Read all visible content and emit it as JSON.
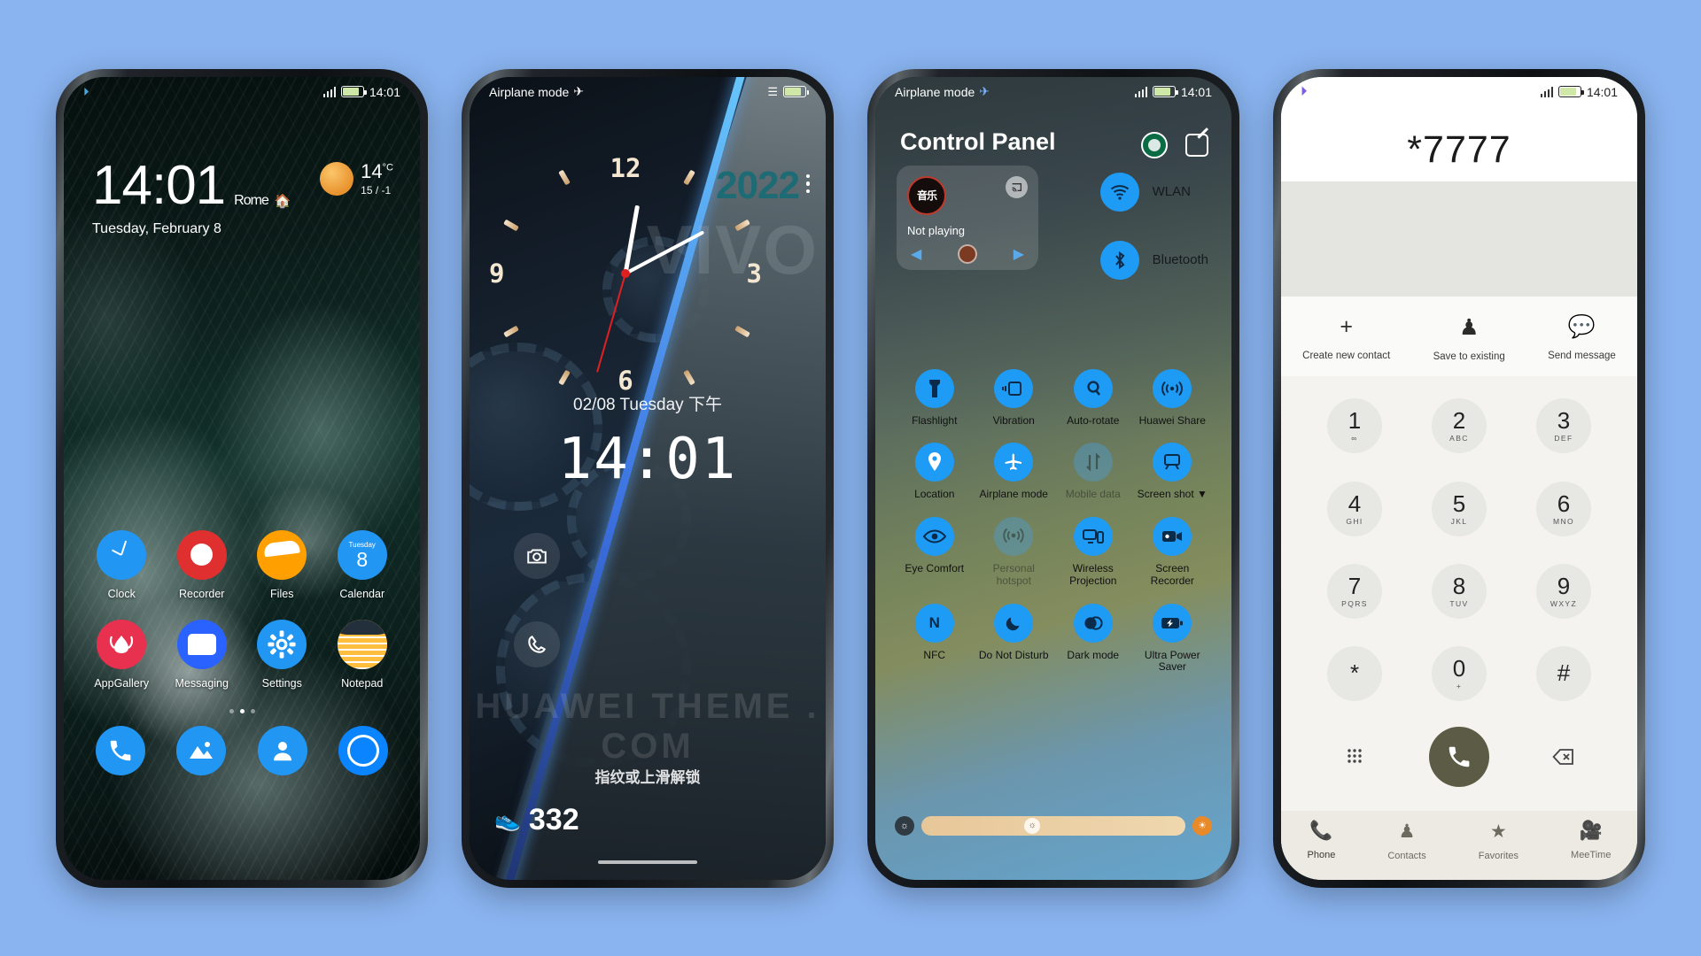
{
  "meta": {
    "background_color": "#8ab4f0"
  },
  "phone1": {
    "name": "lock-screen-home",
    "statusbar": {
      "time": "14:01",
      "battery": "battery-icon",
      "signal": "signal-icon"
    },
    "clock": {
      "time": "14:01",
      "city": "Rome",
      "home_icon": "home-icon",
      "date": "Tuesday, February 8"
    },
    "weather": {
      "icon": "sun-icon",
      "temperature": "14",
      "unit": "°C",
      "range": "15 / -1"
    },
    "apps_row1": [
      {
        "label": "Clock",
        "icon": "clock-app-icon"
      },
      {
        "label": "Recorder",
        "icon": "recorder-app-icon"
      },
      {
        "label": "Files",
        "icon": "files-app-icon"
      },
      {
        "label": "Calendar",
        "icon": "calendar-app-icon",
        "weekday": "Tuesday",
        "day": "8"
      }
    ],
    "apps_row2": [
      {
        "label": "AppGallery",
        "icon": "appgallery-app-icon"
      },
      {
        "label": "Messaging",
        "icon": "messaging-app-icon"
      },
      {
        "label": "Settings",
        "icon": "settings-app-icon"
      },
      {
        "label": "Notepad",
        "icon": "notepad-app-icon"
      }
    ],
    "page_dots": {
      "count": 3,
      "active_index": 1
    },
    "dock": [
      {
        "label": "Phone",
        "icon": "phone-app-icon"
      },
      {
        "label": "Gallery",
        "icon": "gallery-app-icon"
      },
      {
        "label": "Contacts",
        "icon": "contacts-app-icon"
      },
      {
        "label": "Ring",
        "icon": "ring-app-icon"
      }
    ]
  },
  "phone2": {
    "name": "clock-lock-screen",
    "statusbar": {
      "left_text": "Airplane mode",
      "left_icon": "airplane-icon",
      "right_icons": "vibrate-icon battery-icon"
    },
    "year_badge": "2022",
    "brand_watermark": "VIVO",
    "menu_icon": "kebab-menu-icon",
    "analog_numbers": [
      "12",
      "3",
      "6",
      "9"
    ],
    "date_line": "02/08 Tuesday 下午",
    "digital_time": "14:01",
    "shortcuts": [
      {
        "icon": "camera-icon"
      },
      {
        "icon": "phone-icon"
      }
    ],
    "unlock_hint": "指纹或上滑解锁",
    "step_counter": {
      "icon": "shoe-icon",
      "value": "332"
    },
    "watermark": "HUAWEI THEME . COM"
  },
  "phone3": {
    "name": "control-panel",
    "statusbar": {
      "left_text": "Airplane mode",
      "left_icon": "airplane-icon",
      "time": "14:01"
    },
    "title": "Control Panel",
    "header_icons": [
      {
        "name": "starbucks-icon"
      },
      {
        "name": "edit-icon"
      }
    ],
    "player": {
      "album_text": "音乐",
      "state": "Not playing",
      "prev": "prev-icon",
      "next": "next-icon",
      "cast": "cast-icon"
    },
    "right_toggles": [
      {
        "label": "WLAN",
        "icon": "wifi-icon",
        "on": true
      },
      {
        "label": "Bluetooth",
        "icon": "bluetooth-icon",
        "on": true
      }
    ],
    "grid_toggles": [
      {
        "label": "Flashlight",
        "icon": "flashlight-icon",
        "on": true
      },
      {
        "label": "Vibration",
        "icon": "vibration-icon",
        "on": true
      },
      {
        "label": "Auto-rotate",
        "icon": "autorotate-icon",
        "on": true
      },
      {
        "label": "Huawei Share",
        "icon": "huawei-share-icon",
        "on": true
      },
      {
        "label": "Location",
        "icon": "location-icon",
        "on": true
      },
      {
        "label": "Airplane mode",
        "icon": "airplane-icon",
        "on": true
      },
      {
        "label": "Mobile data",
        "icon": "mobile-data-icon",
        "on": false
      },
      {
        "label": "Screen shot",
        "icon": "screenshot-icon",
        "on": true,
        "has_chevron": true
      },
      {
        "label": "Eye Comfort",
        "icon": "eye-icon",
        "on": true
      },
      {
        "label": "Personal hotspot",
        "icon": "hotspot-icon",
        "on": false
      },
      {
        "label": "Wireless Projection",
        "icon": "wireless-projection-icon",
        "on": true
      },
      {
        "label": "Screen Recorder",
        "icon": "screen-recorder-icon",
        "on": true
      },
      {
        "label": "NFC",
        "icon": "nfc-icon",
        "on": true
      },
      {
        "label": "Do Not Disturb",
        "icon": "moon-icon",
        "on": true
      },
      {
        "label": "Dark mode",
        "icon": "dark-mode-icon",
        "on": true
      },
      {
        "label": "Ultra Power Saver",
        "icon": "ultra-power-saver-icon",
        "on": true
      }
    ],
    "brightness_slider": {
      "left_icon": "brightness-low-icon",
      "knob_icon": "brightness-knob-icon",
      "right_icon": "brightness-auto-icon",
      "value_percent": 42
    }
  },
  "phone4": {
    "name": "dialer",
    "statusbar": {
      "left_icon": "telegram-icon",
      "time": "14:01"
    },
    "dialed_number": "*7777",
    "actions": [
      {
        "label": "Create new contact",
        "icon": "plus-icon"
      },
      {
        "label": "Save to existing",
        "icon": "person-icon"
      },
      {
        "label": "Send message",
        "icon": "message-icon"
      }
    ],
    "keys": [
      {
        "digit": "1",
        "letters": "∞"
      },
      {
        "digit": "2",
        "letters": "ABC"
      },
      {
        "digit": "3",
        "letters": "DEF"
      },
      {
        "digit": "4",
        "letters": "GHI"
      },
      {
        "digit": "5",
        "letters": "JKL"
      },
      {
        "digit": "6",
        "letters": "MNO"
      },
      {
        "digit": "7",
        "letters": "PQRS"
      },
      {
        "digit": "8",
        "letters": "TUV"
      },
      {
        "digit": "9",
        "letters": "WXYZ"
      },
      {
        "digit": "*",
        "letters": ""
      },
      {
        "digit": "0",
        "letters": "+"
      },
      {
        "digit": "#",
        "letters": ""
      }
    ],
    "bottom_row": [
      {
        "icon": "keypad-icon"
      },
      {
        "icon": "call-icon"
      },
      {
        "icon": "backspace-icon"
      }
    ],
    "nav": [
      {
        "label": "Phone",
        "icon": "phone-icon",
        "active": true
      },
      {
        "label": "Contacts",
        "icon": "contacts-icon",
        "active": false
      },
      {
        "label": "Favorites",
        "icon": "star-icon",
        "active": false
      },
      {
        "label": "MeeTime",
        "icon": "meetime-icon",
        "active": false
      }
    ]
  }
}
